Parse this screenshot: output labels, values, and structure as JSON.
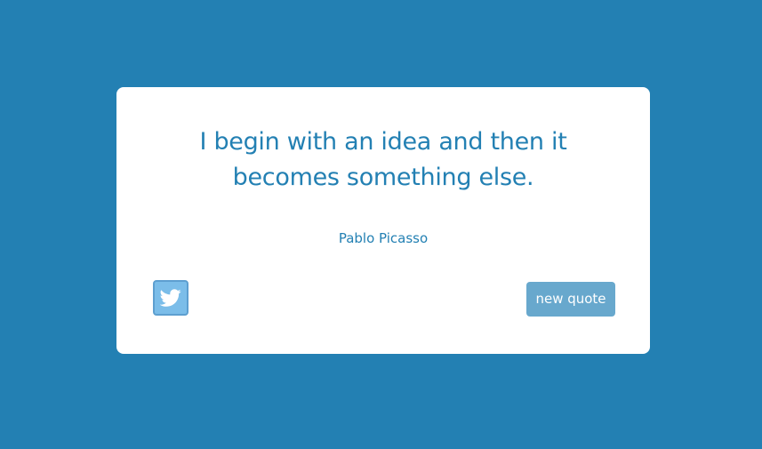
{
  "colors": {
    "background": "#2380b3",
    "card": "#ffffff",
    "text_accent": "#2380b3",
    "tweet_button": "#7bbde9",
    "new_quote_button": "#68a8cd"
  },
  "quote": {
    "text": "I begin with an idea and then it becomes something else.",
    "author": "Pablo Picasso"
  },
  "actions": {
    "tweet_icon": "twitter-bird-icon",
    "new_quote_label": "new quote"
  }
}
